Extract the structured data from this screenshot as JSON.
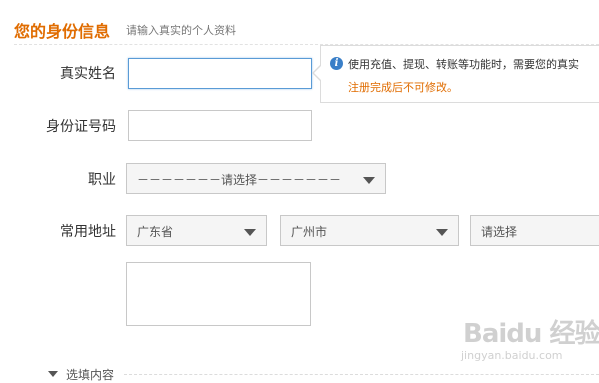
{
  "header": {
    "title": "您的身份信息",
    "subtitle": "请输入真实的个人资料"
  },
  "form": {
    "real_name_label": "真实姓名",
    "real_name_value": "",
    "id_number_label": "身份证号码",
    "id_number_value": "",
    "occupation_label": "职业",
    "occupation_selected": "－－－－－－－请选择－－－－－－－",
    "address_label": "常用地址",
    "province_selected": "广东省",
    "city_selected": "广州市",
    "district_selected": "请选择",
    "address_detail_value": ""
  },
  "tip": {
    "icon": "info-icon",
    "message": "使用充值、提现、转账等功能时，需要您的真实",
    "warning": "注册完成后不可修改。"
  },
  "optional": {
    "label": "选填内容"
  },
  "watermark": {
    "main": "Baidu 经验",
    "url": "jingyan.baidu.com"
  },
  "colors": {
    "accent": "#e06c00",
    "focus_border": "#5a9bd6",
    "info_icon": "#3a7fc8"
  }
}
